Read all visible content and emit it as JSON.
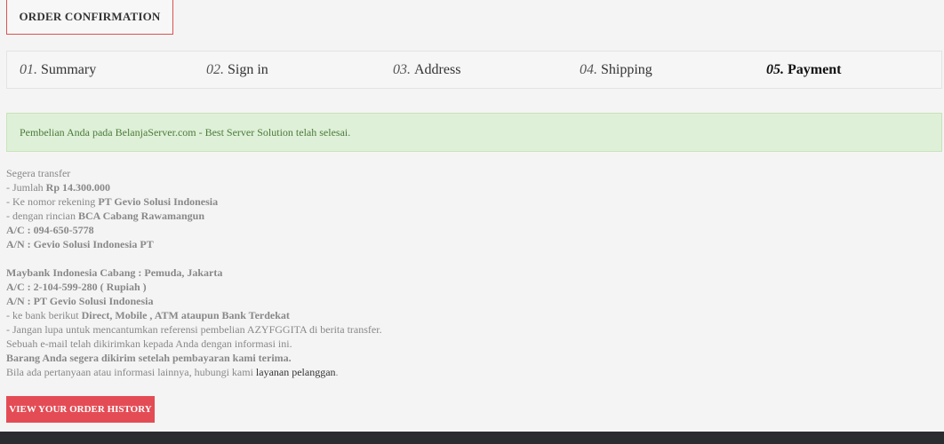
{
  "page": {
    "heading": "ORDER CONFIRMATION"
  },
  "steps": [
    {
      "num": "01.",
      "label": "Summary"
    },
    {
      "num": "02.",
      "label": "Sign in"
    },
    {
      "num": "03.",
      "label": "Address"
    },
    {
      "num": "04.",
      "label": "Shipping"
    },
    {
      "num": "05.",
      "label": "Payment",
      "current": true
    }
  ],
  "alert": {
    "message": "Pembelian Anda pada BelanjaServer.com - Best Server Solution telah selesai."
  },
  "details": {
    "l1": "Segera transfer",
    "l2_pre": "- Jumlah ",
    "l2_b": "Rp 14.300.000",
    "l3_pre": "- Ke nomor rekening ",
    "l3_b": "PT Gevio Solusi Indonesia",
    "l4_pre": "- dengan rincian ",
    "l4_b": "BCA Cabang Rawamangun",
    "l5_b": "A/C : 094-650-5778",
    "l6_b": "A/N : Gevio Solusi Indonesia PT",
    "l8_b": "Maybank Indonesia Cabang : Pemuda, Jakarta",
    "l9_b": "A/C : 2-104-599-280 ( Rupiah )",
    "l10_b": "A/N : PT Gevio Solusi Indonesia",
    "l11_pre": "- ke bank berikut ",
    "l11_b": "Direct, Mobile , ATM ataupun Bank Terdekat",
    "l12": "- Jangan lupa untuk mencantumkan referensi pembelian AZYFGGITA di berita transfer.",
    "l13": "Sebuah e-mail telah dikirimkan kepada Anda dengan informasi ini.",
    "l14_b": "Barang Anda segera dikirim setelah pembayaran kami terima.",
    "l15_pre": "Bila ada pertanyaan atau informasi lainnya, hubungi kami ",
    "l15_link": "layanan pelanggan",
    "l15_post": "."
  },
  "buttons": {
    "history": "VIEW YOUR ORDER HISTORY"
  },
  "colors": {
    "accent": "#e44c55",
    "alert_bg": "#dff0d8",
    "footer": "#2b2c30"
  }
}
